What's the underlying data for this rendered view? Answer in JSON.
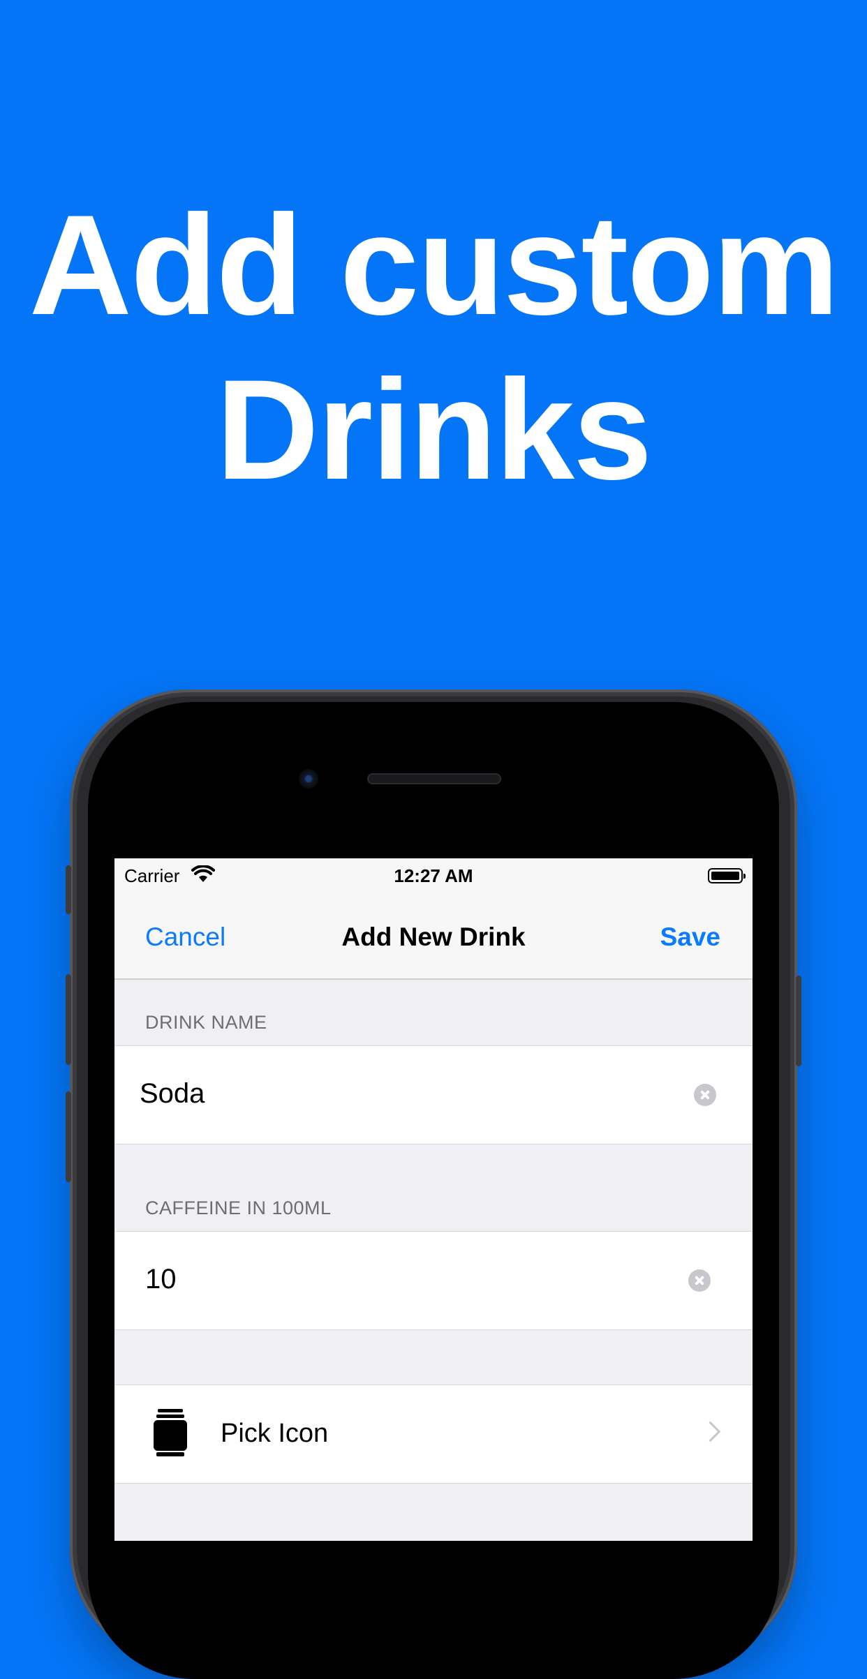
{
  "headline": {
    "line1": "Add custom",
    "line2": "Drinks"
  },
  "status_bar": {
    "carrier": "Carrier",
    "time": "12:27 AM",
    "icons": [
      "wifi-icon",
      "battery-icon"
    ]
  },
  "nav": {
    "cancel_label": "Cancel",
    "title": "Add New Drink",
    "save_label": "Save"
  },
  "form": {
    "drink_name": {
      "header": "DRINK NAME",
      "value": "Soda"
    },
    "caffeine": {
      "header": "CAFFEINE IN 100ML",
      "value": "10"
    },
    "pick_icon": {
      "label": "Pick Icon",
      "icon": "can-icon"
    }
  },
  "colors": {
    "background": "#0475f6",
    "accent": "#0a7aff"
  }
}
